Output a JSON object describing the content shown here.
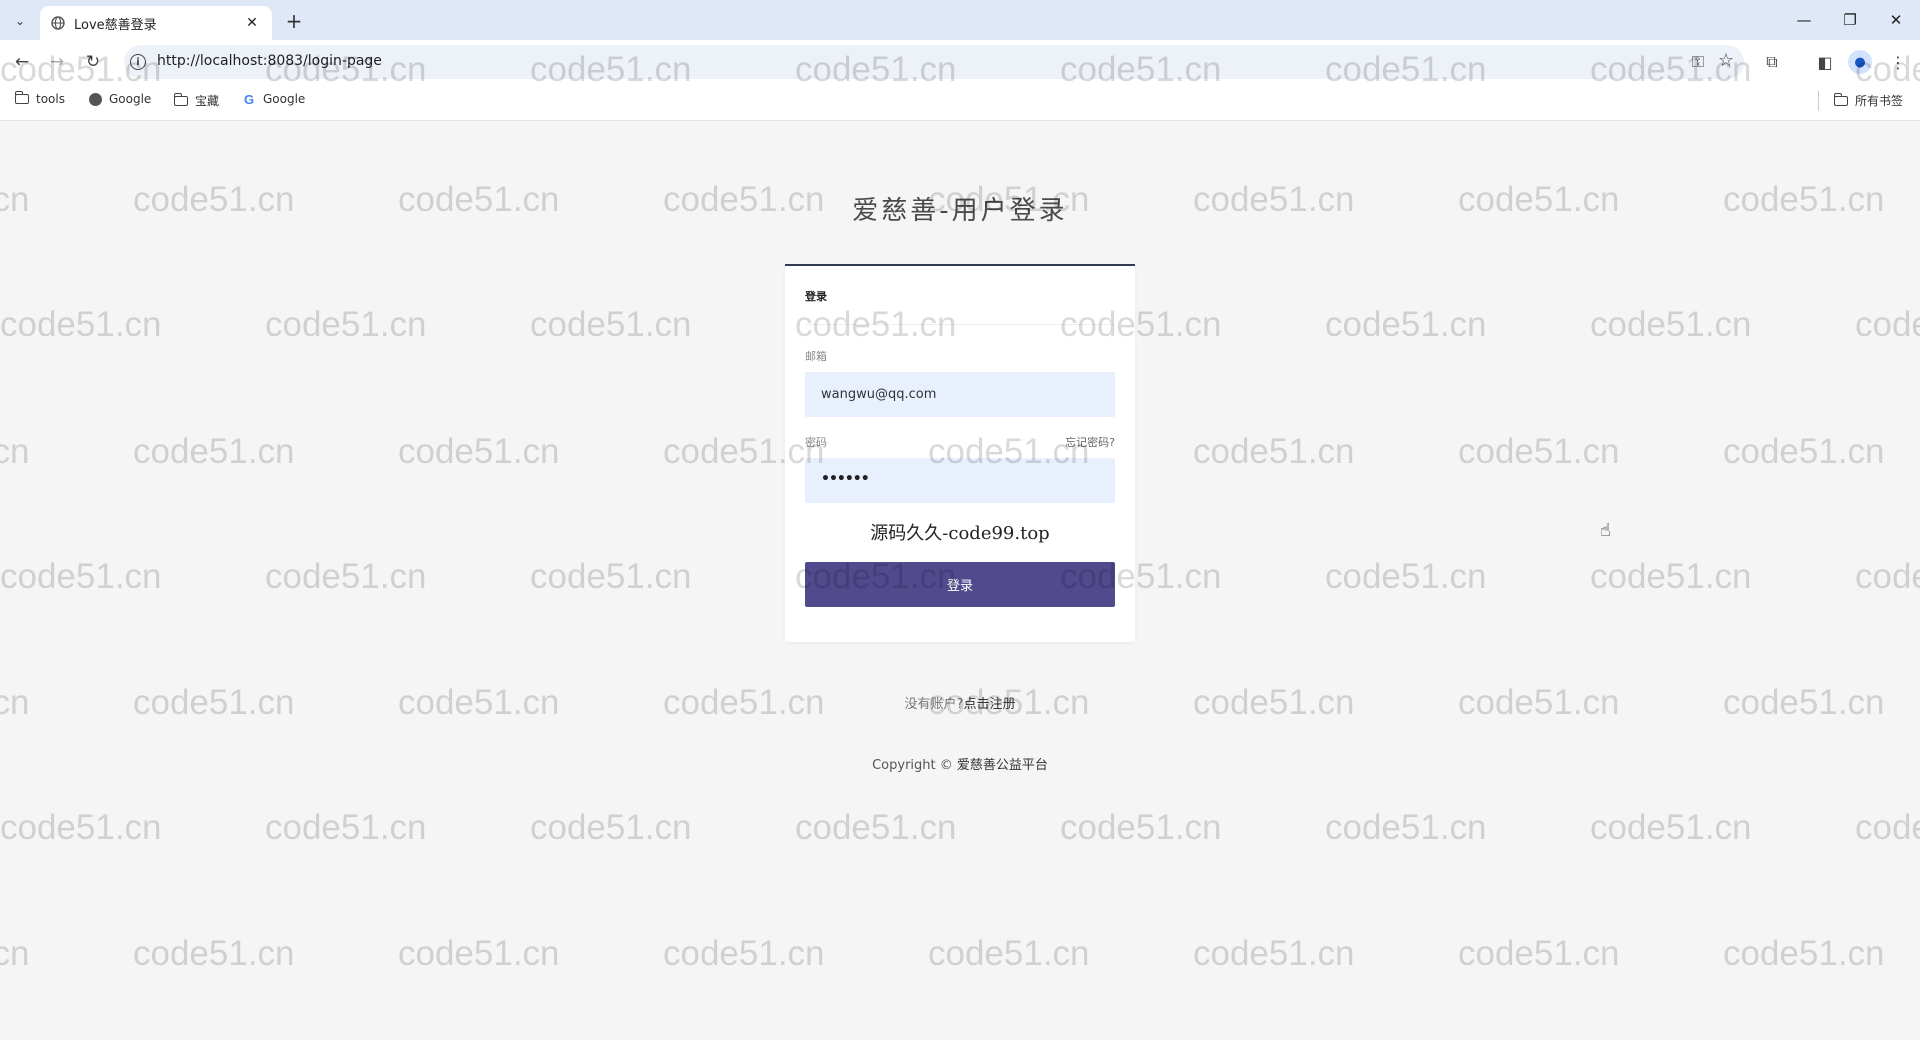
{
  "browser": {
    "tab_title": "Love慈善登录",
    "url": "http://localhost:8083/login-page",
    "bookmarks": [
      {
        "label": "tools",
        "icon": "folder-icon"
      },
      {
        "label": "Google",
        "icon": "globe-icon"
      },
      {
        "label": "宝藏",
        "icon": "folder-icon"
      },
      {
        "label": "Google",
        "icon": "google-g-icon"
      }
    ],
    "all_bookmarks_label": "所有书签"
  },
  "watermark": {
    "text": "code51.cn"
  },
  "page": {
    "title": "爱慈善-用户登录",
    "card_header": "登录",
    "email_label": "邮箱",
    "email_value": "wangwu@qq.com",
    "password_label": "密码",
    "forgot_link": "忘记密码?",
    "password_mask": "••••••",
    "brand_line": "源码久久-code99.top",
    "login_button": "登录",
    "no_account_text": "没有账户?",
    "register_link": "点击注册",
    "copyright_prefix": "Copyright ©",
    "copyright_org": "爱慈善公益平台"
  },
  "colors": {
    "primary_button": "#514b8e",
    "card_top_border": "#333a56",
    "input_background": "#e8f0fe",
    "page_background": "#f5f5f5"
  }
}
